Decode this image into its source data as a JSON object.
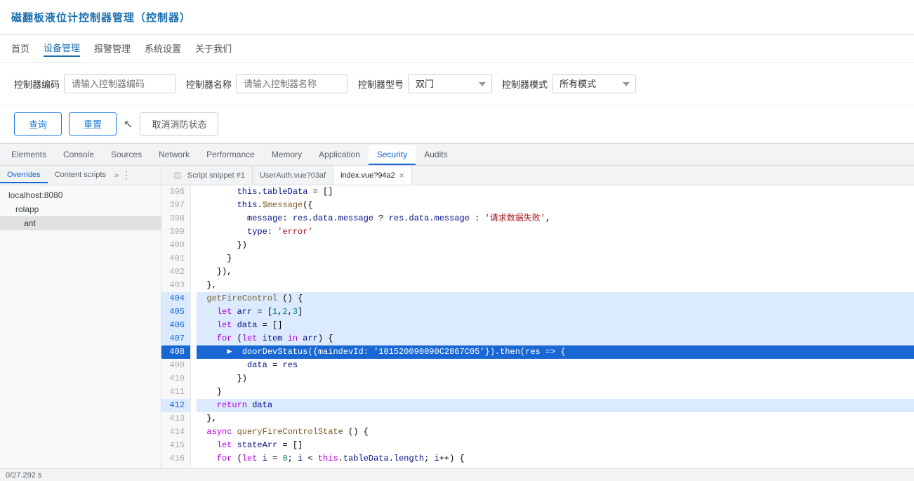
{
  "topbar": {
    "title": "磁翻板液位计控制器管理（控制器）"
  },
  "navbar": {
    "items": [
      {
        "label": "首页",
        "active": false
      },
      {
        "label": "设备管理",
        "active": true
      },
      {
        "label": "报警管理",
        "active": false
      },
      {
        "label": "系统设置",
        "active": false
      },
      {
        "label": "关于我们",
        "active": false
      }
    ]
  },
  "searchbar": {
    "fields": [
      {
        "label": "控制器编码",
        "placeholder": "请输入控制器编码",
        "value": ""
      },
      {
        "label": "控制器名称",
        "placeholder": "请输入控制器名称",
        "value": ""
      },
      {
        "label": "控制器型号",
        "placeholder": "双门",
        "value": "双门"
      },
      {
        "label": "控制器模式",
        "placeholder": "所有模式",
        "value": "所有模式"
      }
    ]
  },
  "buttons": {
    "query": "查询",
    "reset": "重置",
    "cancel_status": "取消消防状态"
  },
  "devtools": {
    "tabs": [
      {
        "label": "Elements",
        "active": false
      },
      {
        "label": "Console",
        "active": false
      },
      {
        "label": "Sources",
        "active": false
      },
      {
        "label": "Network",
        "active": false
      },
      {
        "label": "Performance",
        "active": false
      },
      {
        "label": "Memory",
        "active": false
      },
      {
        "label": "Application",
        "active": false
      },
      {
        "label": "Security",
        "active": true
      },
      {
        "label": "Audits",
        "active": false
      }
    ]
  },
  "sources_sidebar": {
    "tabs": [
      {
        "label": "Overrides",
        "active": true
      },
      {
        "label": "Content scripts",
        "active": false
      }
    ],
    "tree_items": [
      {
        "label": "localhost:8080",
        "level": 0
      },
      {
        "label": "rolapp",
        "level": 1
      },
      {
        "label": "ant",
        "level": 2,
        "active": true
      }
    ]
  },
  "file_tabs": [
    {
      "label": "Script snippet #1",
      "active": false,
      "closable": false,
      "icon": "◫"
    },
    {
      "label": "UserAuth.vue?03af",
      "active": false,
      "closable": false
    },
    {
      "label": "index.vue?94a2",
      "active": true,
      "closable": true
    }
  ],
  "code": {
    "lines": [
      {
        "num": 396,
        "content": "        this.tableData = []",
        "highlight": false
      },
      {
        "num": 397,
        "content": "        this.$message({",
        "highlight": false
      },
      {
        "num": 398,
        "content": "          message: res.data.message ? res.data.message : '请求数据失败',",
        "highlight": false
      },
      {
        "num": 399,
        "content": "          type: 'error'",
        "highlight": false
      },
      {
        "num": 400,
        "content": "        })",
        "highlight": false
      },
      {
        "num": 401,
        "content": "      }",
        "highlight": false
      },
      {
        "num": 402,
        "content": "    }),",
        "highlight": false
      },
      {
        "num": 403,
        "content": "  },",
        "highlight": false
      },
      {
        "num": 404,
        "content": "  getFireControl () {",
        "highlight": true
      },
      {
        "num": 405,
        "content": "    let arr = [1,2,3]",
        "highlight": true
      },
      {
        "num": 406,
        "content": "    let data = []",
        "highlight": true
      },
      {
        "num": 407,
        "content": "    for (let item in arr) {",
        "highlight": true
      },
      {
        "num": 408,
        "content": "      ►  doorDevStatus({maindevId: '101520090090C2867C05'}).then(res => {",
        "highlight": true,
        "arrow": true
      },
      {
        "num": 409,
        "content": "          data = res",
        "highlight": false
      },
      {
        "num": 410,
        "content": "        })",
        "highlight": false
      },
      {
        "num": 411,
        "content": "    }",
        "highlight": false
      },
      {
        "num": 412,
        "content": "    return data",
        "highlight": true
      },
      {
        "num": 413,
        "content": "  },",
        "highlight": false
      },
      {
        "num": 414,
        "content": "  async queryFireControlState () {",
        "highlight": false
      },
      {
        "num": 415,
        "content": "    let stateArr = []",
        "highlight": false
      },
      {
        "num": 416,
        "content": "    for (let i = 0; i < this.tableData.length; i++) {",
        "highlight": false
      }
    ]
  },
  "status_bar": {
    "text": "0/27.292 s"
  }
}
